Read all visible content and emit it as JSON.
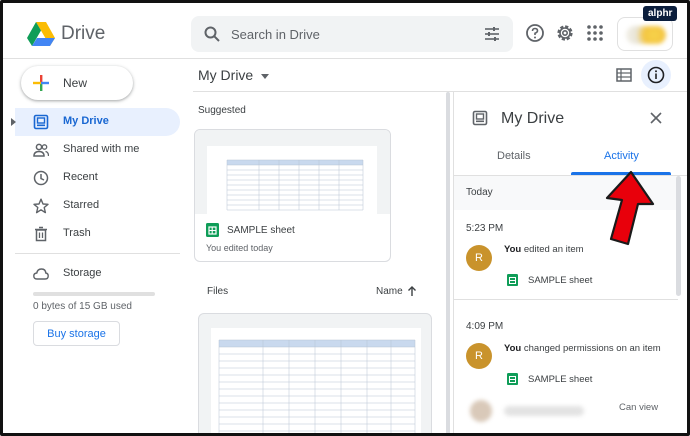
{
  "header": {
    "app_name": "Drive",
    "search_placeholder": "Search in Drive",
    "icons": [
      "search-icon",
      "tune-icon",
      "help-icon",
      "settings-icon",
      "apps-grid-icon"
    ],
    "watermark": "alphr"
  },
  "sidebar": {
    "new_label": "New",
    "items": [
      {
        "label": "My Drive",
        "icon": "my-drive-icon",
        "active": true
      },
      {
        "label": "Shared with me",
        "icon": "shared-people-icon",
        "active": false
      },
      {
        "label": "Recent",
        "icon": "clock-icon",
        "active": false
      },
      {
        "label": "Starred",
        "icon": "star-icon",
        "active": false
      },
      {
        "label": "Trash",
        "icon": "trash-icon",
        "active": false
      },
      {
        "label": "Storage",
        "icon": "cloud-icon",
        "active": false
      }
    ],
    "storage": {
      "used_text": "0 bytes of 15 GB used",
      "used_fraction": 0
    },
    "buy_storage_label": "Buy storage"
  },
  "main": {
    "title": "My Drive",
    "suggested_label": "Suggested",
    "suggested_card": {
      "file_name": "SAMPLE sheet",
      "subtitle": "You edited today"
    },
    "files_label": "Files",
    "sort_label": "Name"
  },
  "details_panel": {
    "title": "My Drive",
    "tabs": [
      {
        "label": "Details",
        "active": false
      },
      {
        "label": "Activity",
        "active": true
      }
    ],
    "day_label": "Today",
    "activities": [
      {
        "time": "5:23 PM",
        "avatar_letter": "R",
        "actor": "You",
        "action": "edited an item",
        "file": "SAMPLE sheet"
      },
      {
        "time": "4:09 PM",
        "avatar_letter": "R",
        "actor": "You",
        "action": "changed permissions on an item",
        "file": "SAMPLE sheet"
      }
    ],
    "access_label": "Can view"
  },
  "colors": {
    "accent": "#1a73e8",
    "active_bg": "#e8f0fe",
    "avatar": "#c9932c",
    "sheets_green": "#0f9d58",
    "arrow_red": "#e8000b"
  }
}
